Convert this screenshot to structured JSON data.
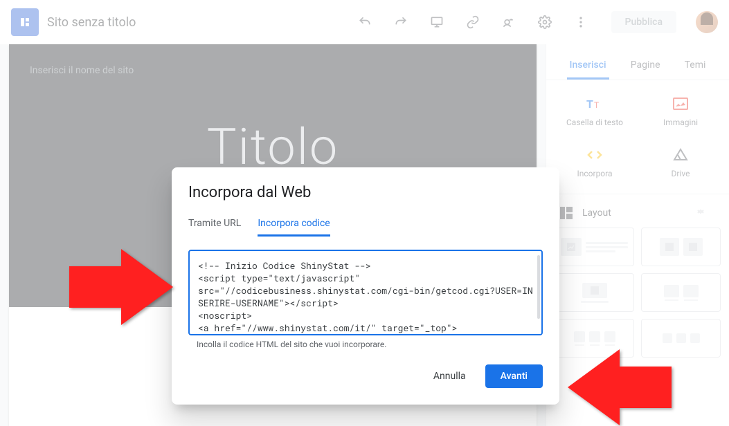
{
  "header": {
    "site_title": "Sito senza titolo",
    "publish_label": "Pubblica"
  },
  "canvas": {
    "site_name_placeholder": "Inserisci il nome del sito",
    "page_title": "Titolo"
  },
  "panel": {
    "tabs": {
      "insert": "Inserisci",
      "pages": "Pagine",
      "themes": "Temi"
    },
    "insert": {
      "text_box": "Casella di testo",
      "images": "Immagini",
      "embed": "Incorpora",
      "drive": "Drive"
    },
    "layout_label": "Layout"
  },
  "dialog": {
    "title": "Incorpora dal Web",
    "tab_url": "Tramite URL",
    "tab_code": "Incorpora codice",
    "code_value": "<!-- Inizio Codice ShinyStat -->\n<script type=\"text/javascript\"\nsrc=\"//codicebusiness.shinystat.com/cgi-bin/getcod.cgi?USER=INSERIRE-USERNAME\"></script>\n<noscript>\n<a href=\"//www.shinystat.com/it/\" target=\"_top\">",
    "helper": "Incolla il codice HTML del sito che vuoi incorporare.",
    "cancel": "Annulla",
    "next": "Avanti"
  }
}
